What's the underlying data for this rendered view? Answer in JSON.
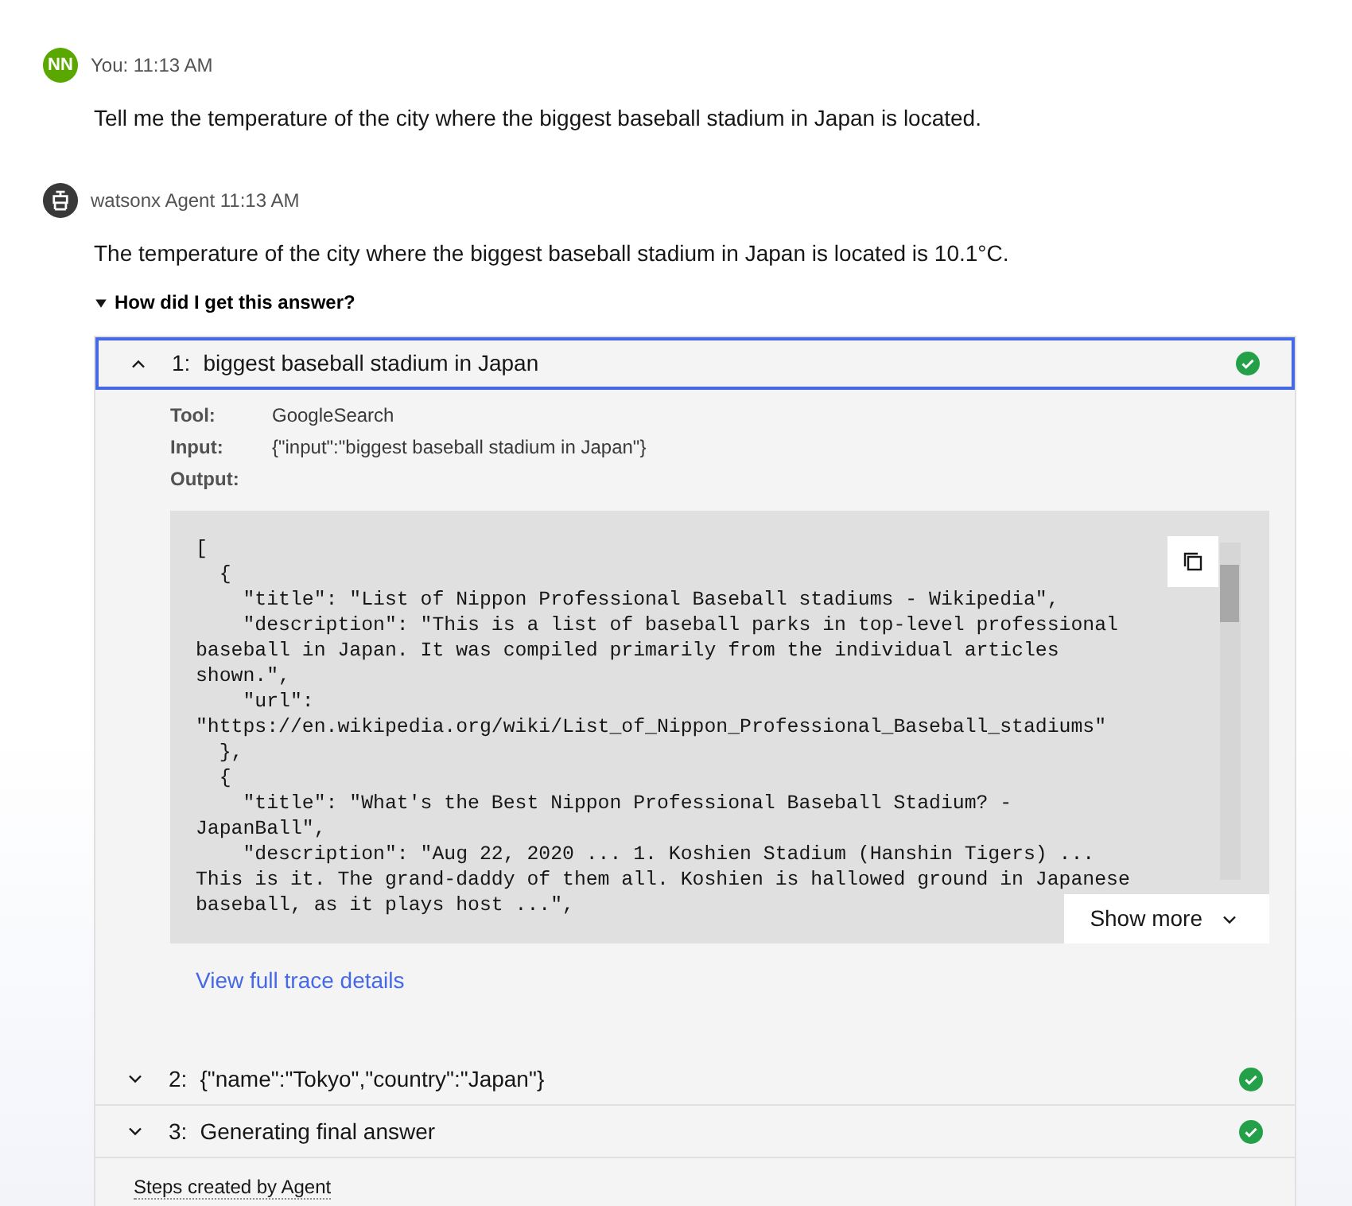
{
  "messages": [
    {
      "kind": "user",
      "avatar": "NN",
      "author": "You: 11:13 AM",
      "text": "Tell me the temperature of the city where the biggest baseball stadium in Japan is located."
    },
    {
      "kind": "agent",
      "author": "watsonx Agent 11:13 AM",
      "text": "The temperature of the city where the biggest baseball stadium in Japan is located is 10.1°C.",
      "reasoning": {
        "label": "How did I get this answer?",
        "expanded": true,
        "steps": [
          {
            "number": "1:",
            "title": "biggest baseball stadium in Japan",
            "expanded": true,
            "selected": true,
            "completed": true,
            "details": [
              {
                "label": "Tool:",
                "value": "GoogleSearch"
              },
              {
                "label": "Input:",
                "value": "{\"input\":\"biggest baseball stadium in Japan\"}"
              },
              {
                "label": "Output:"
              }
            ],
            "output_lines": [
              "[",
              "  {",
              "    \"title\": \"List of Nippon Professional Baseball stadiums - Wikipedia\",",
              "    \"description\": \"This is a list of baseball parks in top-level professional",
              "baseball in Japan. It was compiled primarily from the individual articles",
              "shown.\",",
              "    \"url\":",
              "\"https://en.wikipedia.org/wiki/List_of_Nippon_Professional_Baseball_stadiums\"",
              "  },",
              "  {",
              "    \"title\": \"What's the Best Nippon Professional Baseball Stadium? -",
              "JapanBall\",",
              "    \"description\": \"Aug 22, 2020 ... 1. Koshien Stadium (Hanshin Tigers) ...",
              "This is it. The grand-daddy of them all. Koshien is hallowed ground in Japanese",
              "baseball, as it plays host ...\","
            ],
            "show_more": "Show more",
            "trace_link": "View full trace details"
          },
          {
            "number": "2:",
            "title": "{\"name\":\"Tokyo\",\"country\":\"Japan\"}",
            "expanded": false,
            "selected": false,
            "completed": true
          },
          {
            "number": "3:",
            "title": "Generating final answer",
            "expanded": false,
            "selected": false,
            "completed": true
          }
        ],
        "footer": "Steps created by Agent"
      }
    }
  ]
}
